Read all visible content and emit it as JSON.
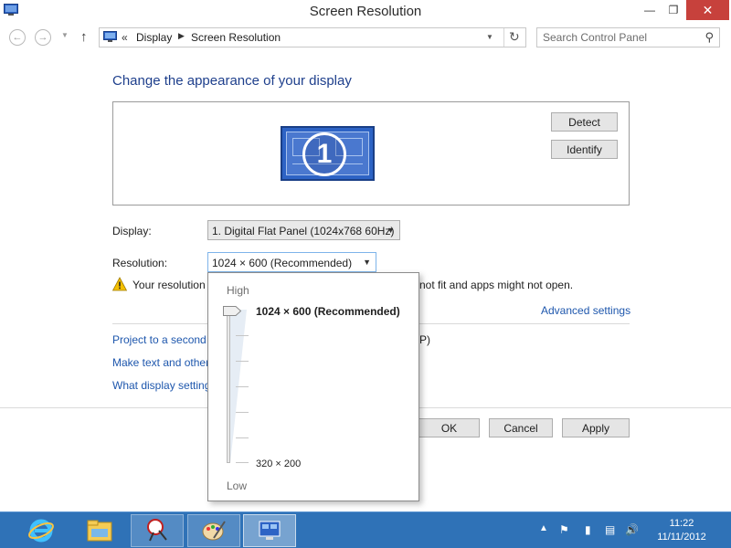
{
  "window": {
    "title": "Screen Resolution"
  },
  "address": {
    "prefix": "«",
    "crumbs": [
      "Display",
      "Screen Resolution"
    ],
    "search_placeholder": "Search Control Panel"
  },
  "main": {
    "heading": "Change the appearance of your display",
    "monitor_number": "1",
    "detect_label": "Detect",
    "identify_label": "Identify",
    "display_label": "Display:",
    "display_value": "1. Digital Flat Panel (1024x768 60Hz)",
    "resolution_label": "Resolution:",
    "resolution_value": "1024 × 600 (Recommended)",
    "warning_text_start": "Your resolution",
    "warning_text_end": "not fit and apps might not open.",
    "advanced_link": "Advanced settings",
    "project_link": "Project to a second",
    "project_tail": "P)",
    "text_link": "Make text and other",
    "what_link": "What display setting",
    "ok_label": "OK",
    "cancel_label": "Cancel",
    "apply_label": "Apply"
  },
  "resolution_popup": {
    "high_label": "High",
    "low_label": "Low",
    "max_resolution": "1024 × 600 (Recommended)",
    "min_resolution": "320 × 200",
    "slider_level": 1.0
  },
  "taskbar": {
    "apps": [
      "internet-explorer",
      "file-explorer",
      "snipping-tool",
      "paint",
      "control-panel"
    ],
    "clock_time": "11:22",
    "clock_date": "11/11/2012"
  },
  "colors": {
    "heading": "#1e3f8c",
    "link": "#1e57ad",
    "close_button": "#c7413c",
    "taskbar": "#2f72b7"
  }
}
